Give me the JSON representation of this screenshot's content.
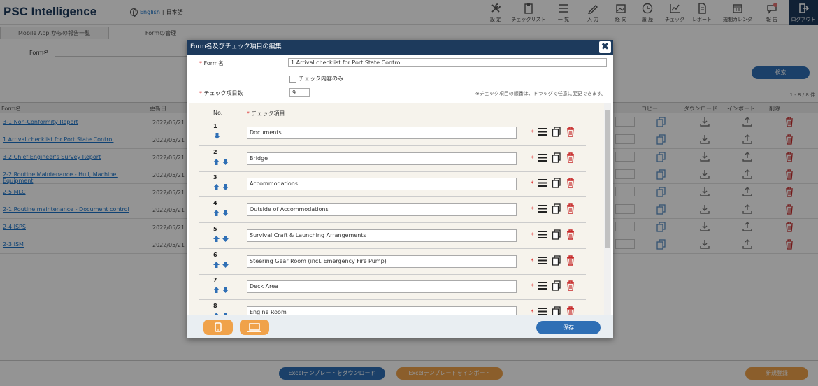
{
  "app": {
    "title": "PSC Intelligence",
    "lang_english": "English",
    "lang_sep": "|",
    "lang_japanese": "日本語"
  },
  "nav": [
    {
      "label": "設 定",
      "icon": "tools-icon"
    },
    {
      "label": "チェックリスト",
      "icon": "clipboard-icon"
    },
    {
      "label": "一 覧",
      "icon": "list-icon"
    },
    {
      "label": "入 力",
      "icon": "pencil-icon"
    },
    {
      "label": "経 向",
      "icon": "image-icon"
    },
    {
      "label": "履 歴",
      "icon": "clock-icon"
    },
    {
      "label": "チェック",
      "icon": "chart-icon"
    },
    {
      "label": "レポート",
      "icon": "document-icon"
    },
    {
      "label": "規制カレンダ",
      "icon": "calendar-icon"
    },
    {
      "label": "報 告",
      "icon": "chat-icon"
    },
    {
      "label": "ログアウト",
      "icon": "logout-icon"
    }
  ],
  "tabs": [
    "Mobile App.からの報告一覧",
    "Formの管理"
  ],
  "filter": {
    "label": "Form名",
    "search_button": "検索"
  },
  "count_text": "1 - 8 / 8 件",
  "table": {
    "headers": {
      "name": "Form名",
      "date": "更新日",
      "copy": "コピー",
      "download": "ダウンロード",
      "import": "インポート",
      "delete": "削除"
    },
    "rows": [
      {
        "name": "3-1.Non-Conformity Report",
        "date": "2022/05/21"
      },
      {
        "name": "1.Arrival checklist for Port State Control",
        "date": "2022/05/21"
      },
      {
        "name": "3-2.Chief Engineer's Survey Report",
        "date": "2022/05/21"
      },
      {
        "name": "2-2.Routine Maintenance - Hull, Machine, Equipment",
        "date": "2022/05/21"
      },
      {
        "name": "2-5.MLC",
        "date": "2022/05/21"
      },
      {
        "name": "2-1.Routine maintenance - Document control",
        "date": "2022/05/21"
      },
      {
        "name": "2-4.ISPS",
        "date": "2022/05/21"
      },
      {
        "name": "2-3.ISM",
        "date": "2022/05/21"
      }
    ]
  },
  "bottom": {
    "download_excel": "Excelテンプレートをダウンロード",
    "import_excel": "Excelテンプレートをインポート",
    "new_register": "新規登録"
  },
  "modal": {
    "title": "Form名及びチェック項目の編集",
    "close": "✖",
    "form_name_label": "Form名",
    "form_name_value": "1.Arrival checklist for Port State Control",
    "check_only_label": "チェック内容のみ",
    "count_label": "チェック項目数",
    "count_value": "9",
    "hint": "※チェック項目の順番は、ドラッグで任意に変更できます。",
    "col_no": "No.",
    "col_item": "チェック項目",
    "required_mark": "*",
    "items": [
      {
        "no": "1",
        "text": "Documents"
      },
      {
        "no": "2",
        "text": "Bridge"
      },
      {
        "no": "3",
        "text": "Accommodations"
      },
      {
        "no": "4",
        "text": "Outside of Accommodations"
      },
      {
        "no": "5",
        "text": "Survival Craft & Launching Arrangements"
      },
      {
        "no": "6",
        "text": "Steering Gear Room (incl. Emergency Fire Pump)"
      },
      {
        "no": "7",
        "text": "Deck Area"
      },
      {
        "no": "8",
        "text": "Engine Room"
      }
    ],
    "save_label": "保存"
  },
  "colors": {
    "navy": "#1d3a5c",
    "blue": "#2f6fb5",
    "orange": "#f0a24a",
    "red": "#c62828"
  }
}
